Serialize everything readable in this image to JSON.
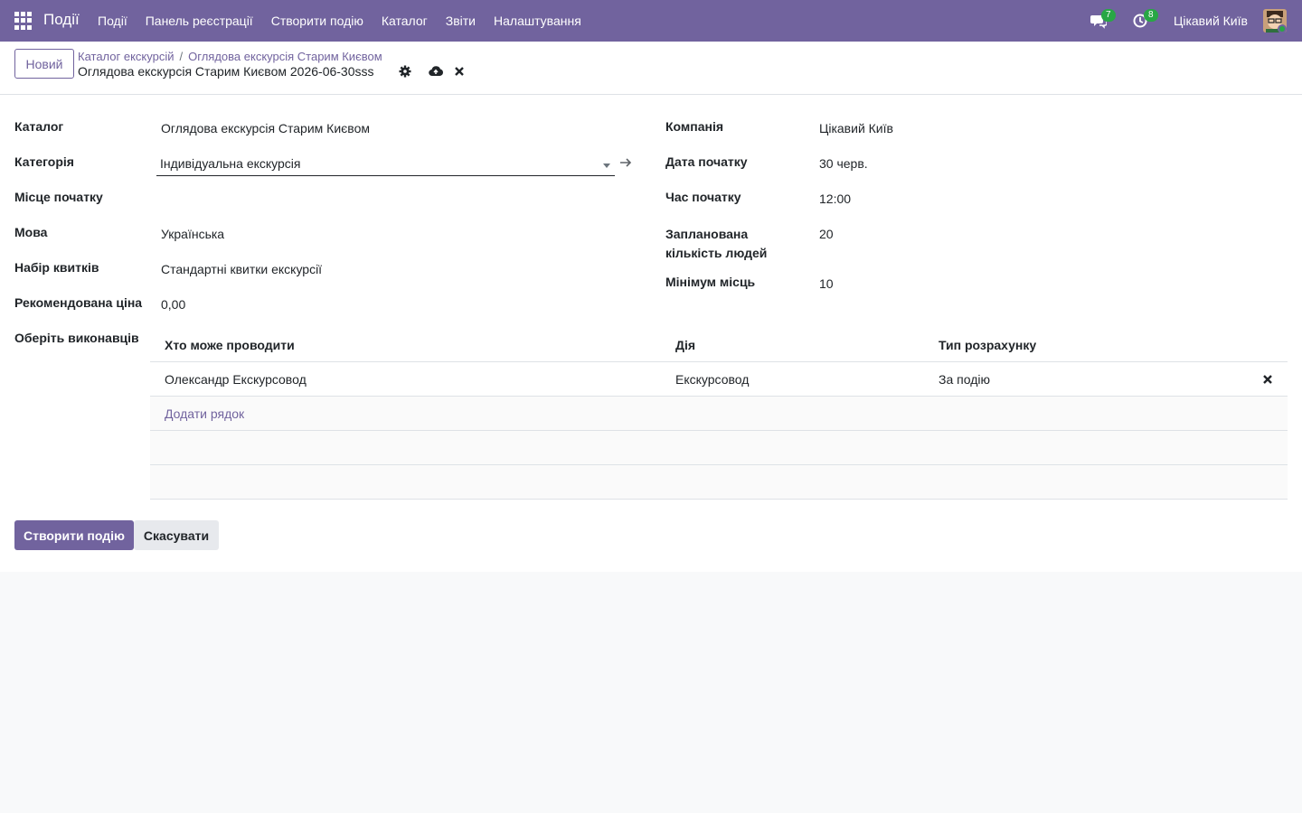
{
  "navbar": {
    "app_name": "Події",
    "menu": [
      "Події",
      "Панель реєстрації",
      "Створити подію",
      "Каталог",
      "Звіти",
      "Налаштування"
    ],
    "messages_count": "7",
    "activities_count": "8",
    "company": "Цікавий Київ"
  },
  "control": {
    "new_label": "Новий",
    "breadcrumb": [
      "Каталог екскурсій",
      "Оглядова екскурсія Старим Києвом"
    ],
    "breadcrumb_sep": "/",
    "record_title": "Оглядова екскурсія Старим Києвом 2026-06-30sss"
  },
  "form": {
    "left": [
      {
        "label": "Каталог",
        "value": "Оглядова екскурсія Старим Києвом"
      },
      {
        "label": "Категорія",
        "value": "Індивідуальна екскурсія"
      },
      {
        "label": "Місце початку",
        "value": ""
      },
      {
        "label": "Мова",
        "value": "Українська"
      },
      {
        "label": "Набір квитків",
        "value": "Стандартні квитки екскурсії"
      },
      {
        "label": "Рекомендована ціна",
        "value": "0,00"
      },
      {
        "label": "Оберіть виконавців",
        "value": ""
      }
    ],
    "right": [
      {
        "label": "Компанія",
        "value": "Цікавий Київ"
      },
      {
        "label": "Дата початку",
        "value": "30 черв."
      },
      {
        "label": "Час початку",
        "value": "12:00"
      },
      {
        "label": "Запланована кількість людей",
        "value": "20"
      },
      {
        "label": "Мінімум місць",
        "value": "10"
      }
    ]
  },
  "performers_table": {
    "headers": [
      "Хто може проводити",
      "Дія",
      "Тип розрахунку"
    ],
    "rows": [
      {
        "who": "Олександр Екскурсовод",
        "action": "Екскурсовод",
        "calc": "За подію"
      }
    ],
    "add_line": "Додати рядок"
  },
  "footer": {
    "create_label": "Створити подію",
    "cancel_label": "Скасувати"
  },
  "colors": {
    "brand": "#71639e",
    "badge": "#28a745"
  }
}
